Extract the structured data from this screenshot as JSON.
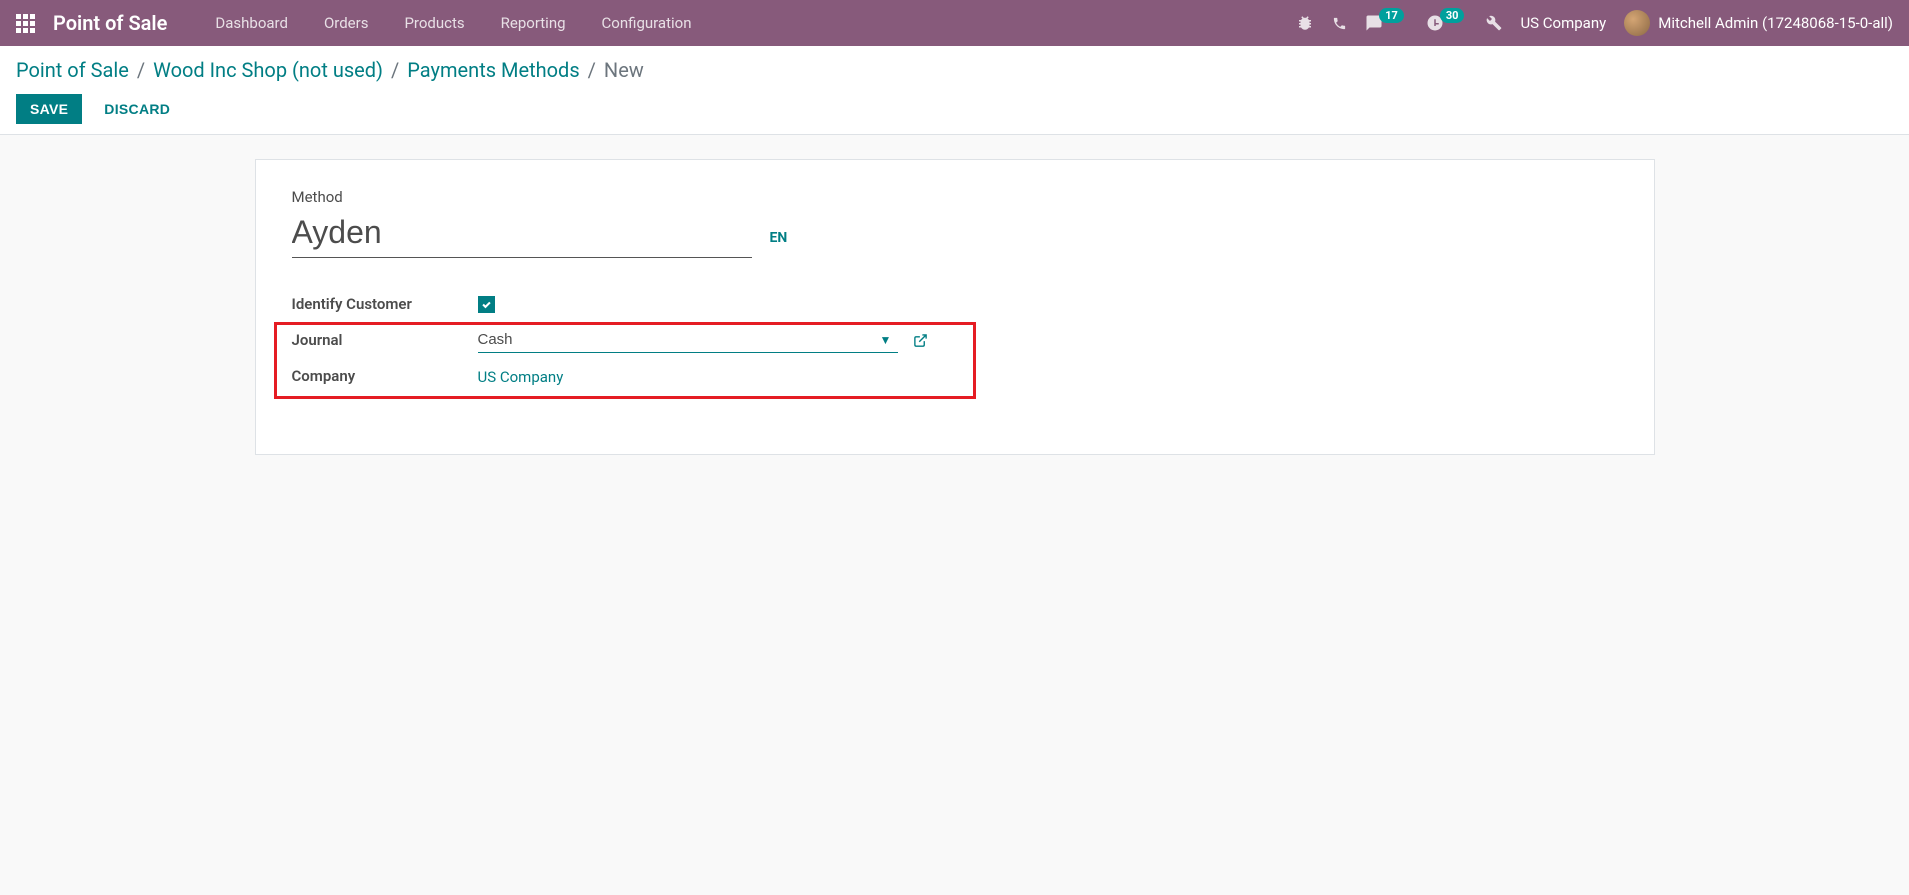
{
  "navbar": {
    "brand": "Point of Sale",
    "menu": [
      "Dashboard",
      "Orders",
      "Products",
      "Reporting",
      "Configuration"
    ],
    "messages_badge": "17",
    "activities_badge": "30",
    "company": "US Company",
    "user": "Mitchell Admin (17248068-15-0-all)"
  },
  "breadcrumb": {
    "items": [
      "Point of Sale",
      "Wood Inc Shop (not used)",
      "Payments Methods"
    ],
    "current": "New"
  },
  "buttons": {
    "save": "Save",
    "discard": "Discard"
  },
  "form": {
    "method_label": "Method",
    "method_value": "Ayden",
    "lang": "EN",
    "identify_customer_label": "Identify Customer",
    "identify_customer_checked": true,
    "journal_label": "Journal",
    "journal_value": "Cash",
    "company_label": "Company",
    "company_value": "US Company"
  }
}
